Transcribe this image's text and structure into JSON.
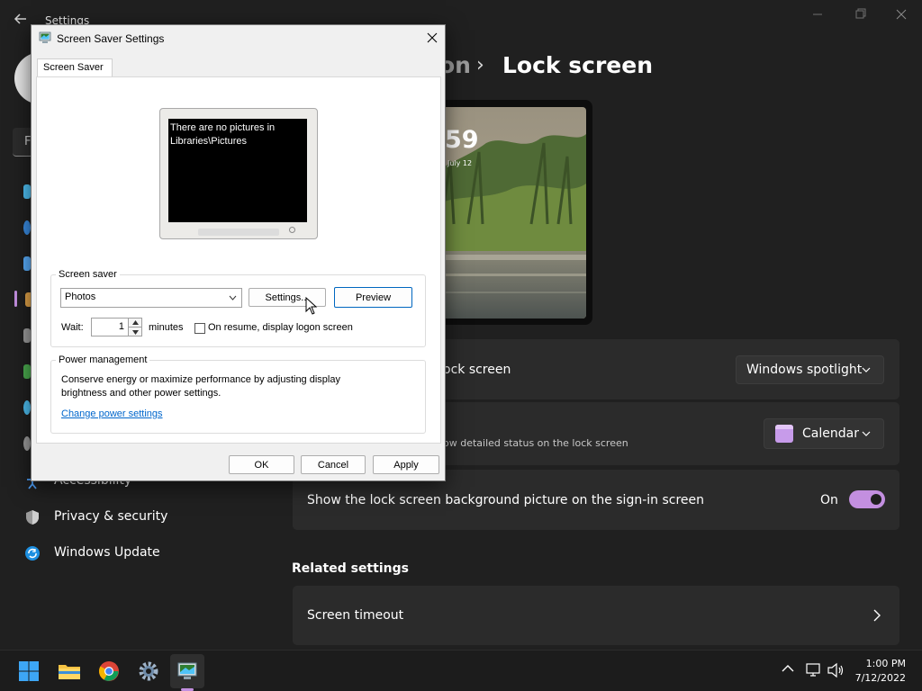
{
  "settings": {
    "app_title": "Settings",
    "breadcrumb_partial": "on",
    "breadcrumb_current": "Lock screen",
    "find_placeholder": "F",
    "nav": [
      {
        "label": "Accessibility"
      },
      {
        "label": "Privacy & security"
      },
      {
        "label": "Windows Update"
      }
    ],
    "preview": {
      "time": "59",
      "date": "July 12"
    },
    "rows": {
      "personalize_label": "ock screen",
      "personalize_value": "Windows spotlight",
      "status_sub": "ow detailed status on the lock screen",
      "status_value": "Calendar",
      "signin_label": "Show the lock screen background picture on the sign-in screen",
      "signin_state": "On",
      "signin_on": true
    },
    "related": {
      "title": "Related settings",
      "timeout_label": "Screen timeout"
    },
    "accent_color": "#c38fe0"
  },
  "dialog": {
    "title": "Screen Saver Settings",
    "tab": "Screen Saver",
    "preview_text": "There are no pictures in Libraries\\Pictures",
    "screensaver_group": "Screen saver",
    "selected_screensaver": "Photos",
    "settings_button": "Settings...",
    "preview_button": "Preview",
    "wait_label": "Wait:",
    "wait_value": "1",
    "minutes_label": "minutes",
    "resume_checkbox_label": "On resume, display logon screen",
    "resume_checked": false,
    "power_group": "Power management",
    "power_text": "Conserve energy or maximize performance by adjusting display brightness and other power settings.",
    "power_link": "Change power settings",
    "ok_button": "OK",
    "cancel_button": "Cancel",
    "apply_button": "Apply"
  },
  "taskbar": {
    "apps": [
      "start-icon",
      "file-explorer-icon",
      "chrome-icon",
      "settings-icon",
      "screen-saver-icon"
    ],
    "time": "1:00 PM",
    "date": "7/12/2022"
  }
}
